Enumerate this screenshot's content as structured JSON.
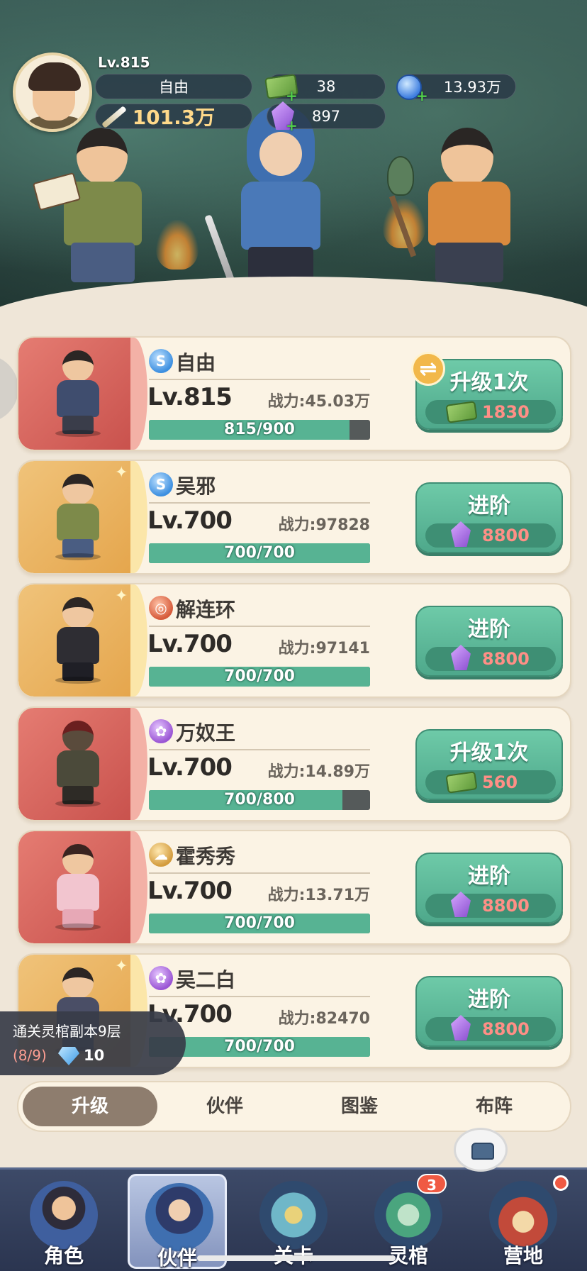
{
  "player": {
    "level": "Lv.815",
    "name": "自由",
    "power": "101.3万"
  },
  "currency": {
    "cash": "38",
    "crystal": "897",
    "gem": "13.93万"
  },
  "heroes": [
    {
      "name": "自由",
      "level": "Lv.815",
      "power": "战力:45.03万",
      "progress": "815/900",
      "progress_ratio": 0.906,
      "action": "升级1次",
      "cost": "1830",
      "cost_type": "cash",
      "element": "water-icon",
      "frame": "red"
    },
    {
      "name": "吴邪",
      "level": "Lv.700",
      "power": "战力:97828",
      "progress": "700/700",
      "progress_ratio": 1.0,
      "action": "进阶",
      "cost": "8800",
      "cost_type": "crystal",
      "element": "water-icon",
      "frame": "gold"
    },
    {
      "name": "解连环",
      "level": "Lv.700",
      "power": "战力:97141",
      "progress": "700/700",
      "progress_ratio": 1.0,
      "action": "进阶",
      "cost": "8800",
      "cost_type": "crystal",
      "element": "fire-icon",
      "frame": "gold"
    },
    {
      "name": "万奴王",
      "level": "Lv.700",
      "power": "战力:14.89万",
      "progress": "700/800",
      "progress_ratio": 0.875,
      "action": "升级1次",
      "cost": "560",
      "cost_type": "cash",
      "element": "lotus-icon",
      "frame": "red"
    },
    {
      "name": "霍秀秀",
      "level": "Lv.700",
      "power": "战力:13.71万",
      "progress": "700/700",
      "progress_ratio": 1.0,
      "action": "进阶",
      "cost": "8800",
      "cost_type": "crystal",
      "element": "earth-icon",
      "frame": "red"
    },
    {
      "name": "吴二白",
      "level": "Lv.700",
      "power": "战力:82470",
      "progress": "700/700",
      "progress_ratio": 1.0,
      "action": "进阶",
      "cost": "8800",
      "cost_type": "crystal",
      "element": "lotus-icon",
      "frame": "gold"
    }
  ],
  "quest": {
    "title": "通关灵棺副本9层",
    "progress": "(8/9)",
    "reward": "10"
  },
  "subtabs": [
    "升级",
    "伙伴",
    "图鉴",
    "布阵"
  ],
  "bottom_nav": [
    {
      "label": "角色"
    },
    {
      "label": "伙伴"
    },
    {
      "label": "关卡"
    },
    {
      "label": "灵棺",
      "badge": "3"
    },
    {
      "label": "营地"
    }
  ],
  "colors": {
    "accent_green": "#57b393",
    "cost_red": "#ff8f86",
    "card_bg": "#fbf3e4",
    "nav_bg": "#2b3550"
  }
}
